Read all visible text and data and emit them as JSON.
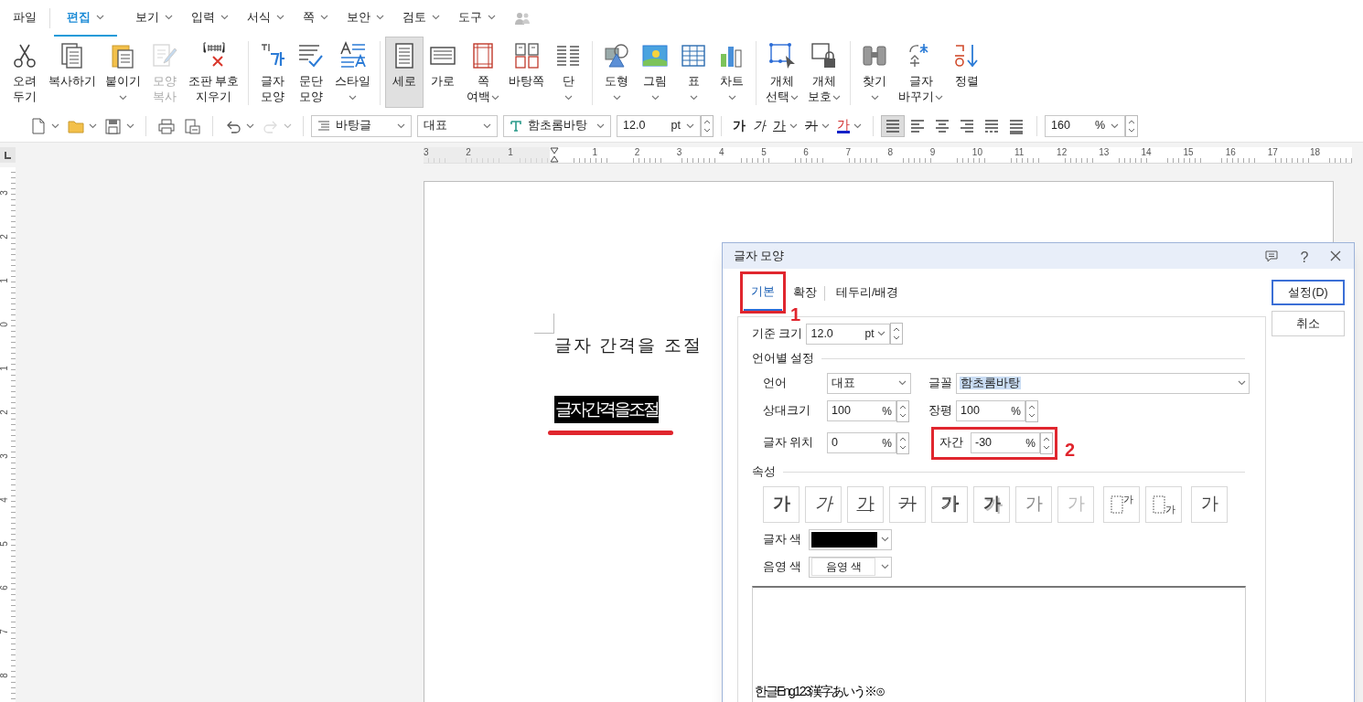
{
  "menu": [
    {
      "label": "파일",
      "selected": false,
      "dropdown": false
    },
    {
      "label": "편집",
      "selected": true,
      "dropdown": true
    },
    {
      "label": "보기",
      "selected": false,
      "dropdown": true
    },
    {
      "label": "입력",
      "selected": false,
      "dropdown": true
    },
    {
      "label": "서식",
      "selected": false,
      "dropdown": true
    },
    {
      "label": "쪽",
      "selected": false,
      "dropdown": true
    },
    {
      "label": "보안",
      "selected": false,
      "dropdown": true
    },
    {
      "label": "검토",
      "selected": false,
      "dropdown": true
    },
    {
      "label": "도구",
      "selected": false,
      "dropdown": true
    }
  ],
  "ribbon": {
    "groups": [
      [
        {
          "lines": [
            "오려",
            "두기"
          ],
          "dropdown": false,
          "disabled": false,
          "selected": false
        },
        {
          "lines": [
            "복사하기"
          ],
          "dropdown": false,
          "disabled": false,
          "selected": false
        },
        {
          "lines": [
            "붙이기"
          ],
          "dropdown": true,
          "disabled": false,
          "selected": false
        },
        {
          "lines": [
            "모양",
            "복사"
          ],
          "dropdown": false,
          "disabled": true,
          "selected": false
        },
        {
          "lines": [
            "조판 부호",
            "지우기"
          ],
          "dropdown": false,
          "disabled": false,
          "selected": false
        }
      ],
      [
        {
          "lines": [
            "글자",
            "모양"
          ],
          "dropdown": false,
          "disabled": false,
          "selected": false
        },
        {
          "lines": [
            "문단",
            "모양"
          ],
          "dropdown": false,
          "disabled": false,
          "selected": false
        },
        {
          "lines": [
            "스타일"
          ],
          "dropdown": true,
          "disabled": false,
          "selected": false
        }
      ],
      [
        {
          "lines": [
            "세로"
          ],
          "dropdown": false,
          "disabled": false,
          "selected": true
        },
        {
          "lines": [
            "가로"
          ],
          "dropdown": false,
          "disabled": false,
          "selected": false
        },
        {
          "lines": [
            "쪽",
            "여백"
          ],
          "dropdown": true,
          "disabled": false,
          "selected": false
        },
        {
          "lines": [
            "바탕쪽"
          ],
          "dropdown": false,
          "disabled": false,
          "selected": false
        },
        {
          "lines": [
            "단"
          ],
          "dropdown": true,
          "disabled": false,
          "selected": false
        }
      ],
      [
        {
          "lines": [
            "도형"
          ],
          "dropdown": true,
          "disabled": false,
          "selected": false
        },
        {
          "lines": [
            "그림"
          ],
          "dropdown": true,
          "disabled": false,
          "selected": false
        },
        {
          "lines": [
            "표"
          ],
          "dropdown": true,
          "disabled": false,
          "selected": false
        },
        {
          "lines": [
            "차트"
          ],
          "dropdown": true,
          "disabled": false,
          "selected": false
        }
      ],
      [
        {
          "lines": [
            "개체",
            "선택"
          ],
          "dropdown": true,
          "disabled": false,
          "selected": false
        },
        {
          "lines": [
            "개체",
            "보호"
          ],
          "dropdown": true,
          "disabled": false,
          "selected": false
        }
      ],
      [
        {
          "lines": [
            "찾기"
          ],
          "dropdown": true,
          "disabled": false,
          "selected": false
        },
        {
          "lines": [
            "글자",
            "바꾸기"
          ],
          "dropdown": true,
          "disabled": false,
          "selected": false
        },
        {
          "lines": [
            "정렬"
          ],
          "dropdown": false,
          "disabled": false,
          "selected": false
        }
      ]
    ]
  },
  "toolbar": {
    "icon_groups": [
      [
        {
          "dropdown": true,
          "disabled": false
        },
        {
          "dropdown": true,
          "disabled": false
        },
        {
          "dropdown": true,
          "disabled": false
        }
      ],
      [
        {
          "dropdown": false,
          "disabled": false
        },
        {
          "dropdown": false,
          "disabled": false
        }
      ],
      [
        {
          "dropdown": true,
          "disabled": false
        },
        {
          "dropdown": true,
          "disabled": true
        }
      ]
    ],
    "style_box": {
      "value": "바탕글"
    },
    "language_box": {
      "value": "대표"
    },
    "font_box": {
      "value": "함초롬바탕"
    },
    "size_box": {
      "value": "12.0",
      "unit": "pt"
    },
    "format_buttons": [
      {
        "glyph": "가",
        "kind": "bold",
        "dropdown": false
      },
      {
        "glyph": "가",
        "kind": "italic",
        "dropdown": false
      },
      {
        "glyph": "가",
        "kind": "underline",
        "dropdown": true
      },
      {
        "glyph": "가",
        "kind": "strike",
        "dropdown": true
      },
      {
        "glyph": "가",
        "kind": "color",
        "dropdown": true
      }
    ],
    "align_buttons": [
      {
        "selected": true
      },
      {
        "selected": false
      },
      {
        "selected": false
      },
      {
        "selected": false
      },
      {
        "selected": false
      },
      {
        "selected": false
      }
    ],
    "zoom_box": {
      "value": "160",
      "unit": "%"
    }
  },
  "horizontal_ruler": {
    "left_labels": [
      "3",
      "2",
      "1"
    ],
    "right_labels": [
      "1",
      "2",
      "3",
      "4",
      "5",
      "6",
      "7",
      "8",
      "9",
      "10",
      "11",
      "12",
      "13",
      "14",
      "15",
      "16",
      "17",
      "18"
    ]
  },
  "vertical_ruler": {
    "labels": [
      "3",
      "2",
      "1",
      "0",
      "1",
      "2",
      "3",
      "4",
      "5",
      "6",
      "7",
      "8"
    ]
  },
  "document": {
    "lines": [
      {
        "text": "글자 간격을 조절",
        "selected": false,
        "annotated": false
      },
      {
        "text": "글자간격을조절",
        "selected": true,
        "annotated": true
      }
    ]
  },
  "dialog": {
    "title": "글자 모양",
    "help": "?",
    "tabs": [
      {
        "label": "기본",
        "selected": true,
        "annotation": "1"
      },
      {
        "label": "확장",
        "selected": false
      },
      {
        "label": "테두리/배경",
        "selected": false
      }
    ],
    "buttons": [
      {
        "label": "설정(D)",
        "default": true
      },
      {
        "label": "취소",
        "default": false
      }
    ],
    "base_size": {
      "label": "기준 크기",
      "value": "12.0",
      "unit": "pt"
    },
    "language_section": {
      "title": "언어별 설정",
      "language": {
        "label": "언어",
        "value": "대표"
      },
      "font": {
        "label": "글꼴",
        "value": "함초롬바탕"
      },
      "fields": [
        {
          "label": "상대크기",
          "value": "100",
          "unit": "%"
        },
        {
          "label": "장평",
          "value": "100",
          "unit": "%"
        },
        {
          "label": "글자 위치",
          "value": "0",
          "unit": "%"
        },
        {
          "label": "자간",
          "value": "-30",
          "unit": "%",
          "annotation": "2"
        }
      ]
    },
    "attributes": {
      "title": "속성",
      "buttons": [
        {
          "glyph": "가",
          "kind": "bold"
        },
        {
          "glyph": "가",
          "kind": "italic"
        },
        {
          "glyph": "가",
          "kind": "underline"
        },
        {
          "glyph": "가",
          "kind": "strike"
        },
        {
          "glyph": "가",
          "kind": "outline"
        },
        {
          "glyph": "가",
          "kind": "shadow"
        },
        {
          "glyph": "가",
          "kind": "emboss"
        },
        {
          "glyph": "가",
          "kind": "engrave"
        },
        {
          "glyph": "가",
          "kind": "superscript"
        },
        {
          "glyph": "가",
          "kind": "subscript"
        },
        {
          "glyph": "가",
          "kind": "normal"
        }
      ]
    },
    "text_color": {
      "label": "글자 색",
      "color": "#000000"
    },
    "shade_color": {
      "label": "음영 색",
      "value": "음영 색"
    },
    "preview": {
      "text": "한글Eng123漢字あいう※⊙"
    }
  }
}
